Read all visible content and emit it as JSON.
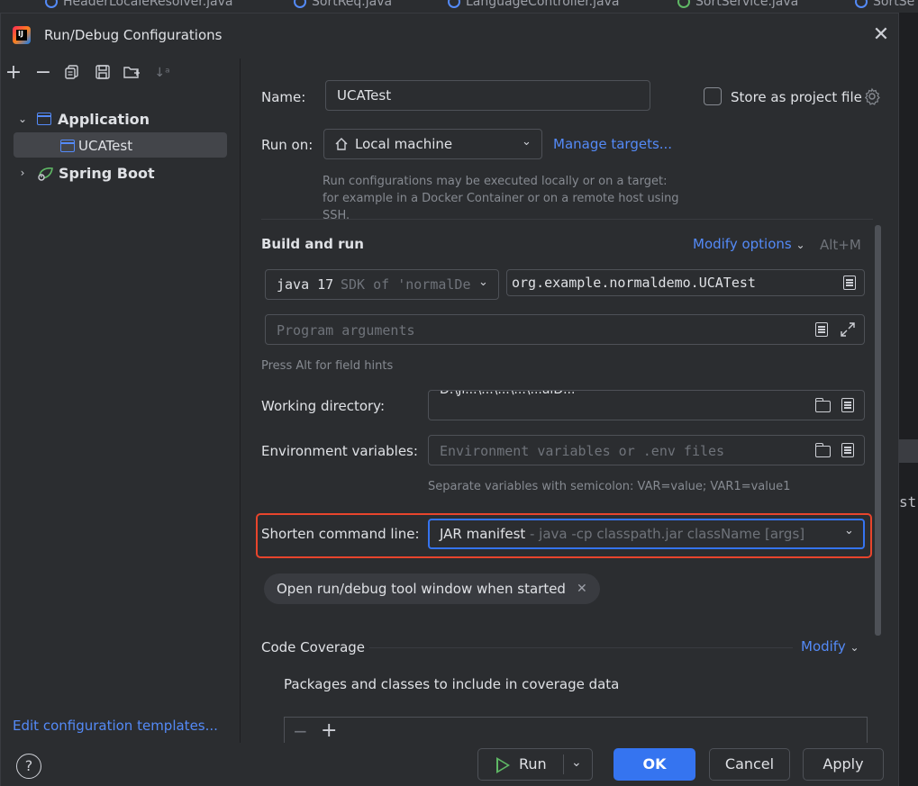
{
  "background_tabs": [
    {
      "label": "HeaderLocaleResolver.java",
      "icon": "java-class-icon"
    },
    {
      "label": "SortReq.java",
      "icon": "java-class-icon"
    },
    {
      "label": "LanguageController.java",
      "icon": "java-class-icon"
    },
    {
      "label": "SortService.java",
      "icon": "java-interface-icon"
    },
    {
      "label": "SortSe",
      "icon": "java-class-icon"
    }
  ],
  "background_editor_fragment": "st",
  "dialog": {
    "title": "Run/Debug Configurations",
    "close_icon": "close-icon"
  },
  "left_panel": {
    "toolbar": [
      "add-icon",
      "remove-icon",
      "copy-icon",
      "save-icon",
      "new-folder-icon",
      "sort-icon"
    ],
    "tree": {
      "application": {
        "label": "Application",
        "expanded": true,
        "children": [
          {
            "label": "UCATest",
            "selected": true
          }
        ]
      },
      "spring_boot": {
        "label": "Spring Boot",
        "expanded": false
      }
    },
    "edit_templates_link": "Edit configuration templates..."
  },
  "form": {
    "name_label": "Name:",
    "name_value": "UCATest",
    "store_as_project_file_label": "Store as project file",
    "store_as_project_file_checked": false,
    "run_on_label": "Run on:",
    "run_on_value": "Local machine",
    "manage_targets_link": "Manage targets...",
    "run_on_hint": "Run configurations may be executed locally or on a target: for example in a Docker Container or on a remote host using SSH.",
    "build_and_run_title": "Build and run",
    "modify_options_link": "Modify options",
    "modify_options_shortcut": "Alt+M",
    "jdk_value": "java 17",
    "jdk_detail": "SDK of 'normalDe",
    "main_class_value": "org.example.normaldemo.UCATest",
    "program_arguments_placeholder": "Program arguments",
    "field_hints_note": "Press Alt for field hints",
    "working_directory_label": "Working directory:",
    "working_directory_value": "D:\\Ji...\\...\\...\\...\\...alD...",
    "environment_variables_label": "Environment variables:",
    "environment_variables_placeholder": "Environment variables or .env files",
    "environment_variables_hint": "Separate variables with semicolon: VAR=value; VAR1=value1",
    "shorten_command_line_label": "Shorten command line:",
    "shorten_command_line_value": "JAR manifest",
    "shorten_command_line_detail": "- java -cp classpath.jar className [args]",
    "open_tool_window_chip": "Open run/debug tool window when started",
    "code_coverage_title": "Code Coverage",
    "modify_link": "Modify",
    "packages_label": "Packages and classes to include in coverage data"
  },
  "buttons": {
    "help": "?",
    "run": "Run",
    "ok": "OK",
    "cancel": "Cancel",
    "apply": "Apply"
  },
  "colors": {
    "accent": "#3574f0",
    "link": "#548af7",
    "highlight_border": "#e8452c",
    "run_green": "#5fb865"
  }
}
